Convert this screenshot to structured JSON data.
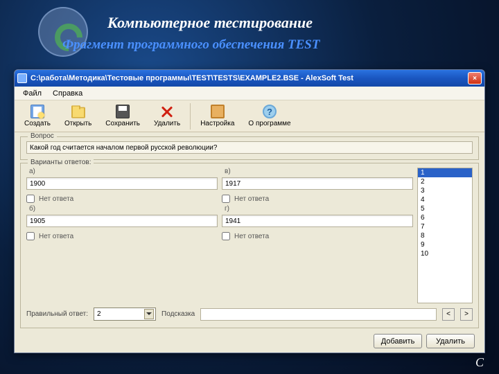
{
  "slide": {
    "title": "Компьютерное тестирование",
    "subtitle": "Фрагмент  программного обеспечения TEST",
    "footer": "С"
  },
  "titlebar": {
    "text": "C:\\работа\\Методика\\Тестовые программы\\TEST\\TESTS\\EXAMPLE2.BSE - AlexSoft Test",
    "close": "×"
  },
  "menu": {
    "file": "Файл",
    "help": "Справка"
  },
  "toolbar": {
    "new": "Создать",
    "open": "Открыть",
    "save": "Сохранить",
    "delete": "Удалить",
    "settings": "Настройка",
    "about": "О программе"
  },
  "question": {
    "legend": "Вопрос",
    "text": "Какой год считается началом первой русской революции?"
  },
  "answers": {
    "legend": "Варианты ответов:",
    "a_label": "а)",
    "a_value": "1900",
    "b_label": "б)",
    "b_value": "1905",
    "v_label": "в)",
    "v_value": "1917",
    "g_label": "г)",
    "g_value": "1941",
    "none": "Нет ответа"
  },
  "list": {
    "items": [
      "1",
      "2",
      "3",
      "4",
      "5",
      "6",
      "7",
      "8",
      "9",
      "10"
    ]
  },
  "bottom": {
    "correct_label": "Правильный ответ:",
    "correct_value": "2",
    "hint_label": "Подсказка",
    "hint_value": "",
    "prev": "<",
    "next": ">"
  },
  "footer_buttons": {
    "add": "Добавить",
    "del": "Удалить"
  }
}
